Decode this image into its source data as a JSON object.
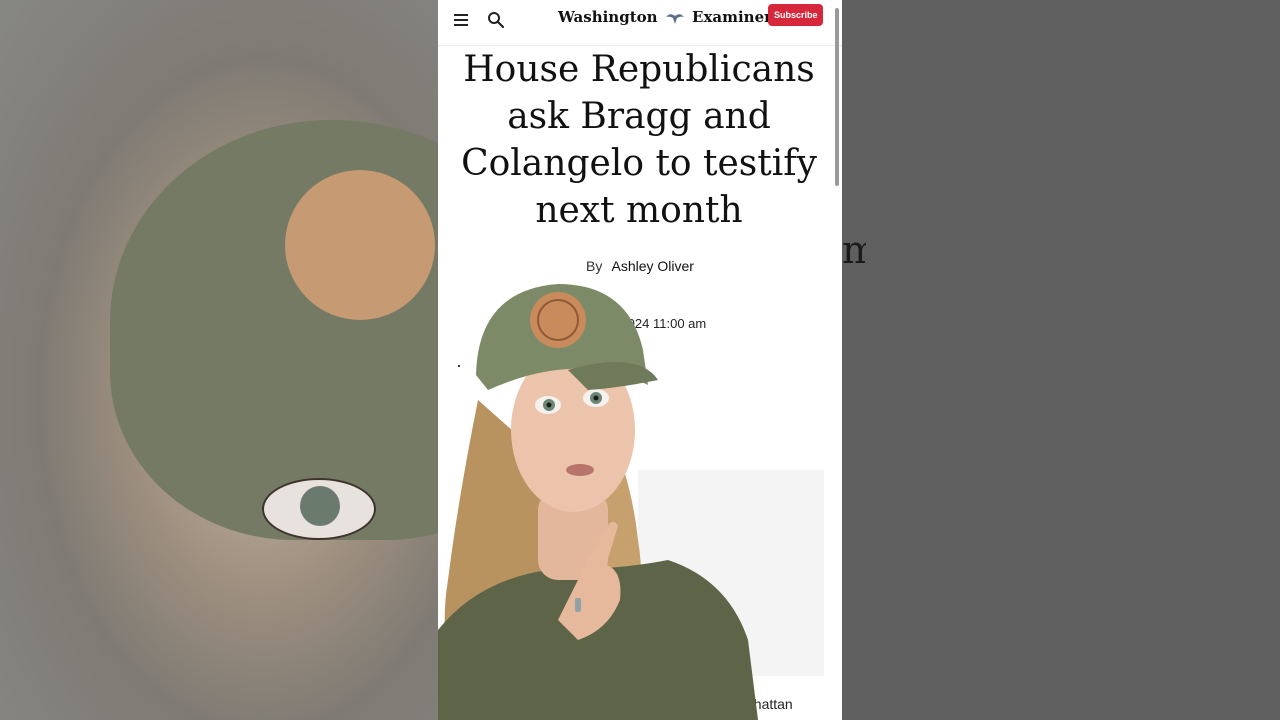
{
  "header": {
    "logo_text_1": "Washington",
    "logo_text_2": "Examiner",
    "subscribe_label": "Subscribe"
  },
  "article": {
    "headline": "House Republicans ask Bragg and Colangelo to testify next month",
    "by_label": "By",
    "author": "Ashley Oliver",
    "date_fragment": "1, 2024 11:00 am",
    "body_fragment": "nhattan"
  },
  "background": {
    "right_fragment": "m"
  },
  "icons": [
    "menu-icon",
    "search-icon",
    "eagle-icon"
  ],
  "colors": {
    "subscribe": "#d6283a",
    "cap": "#7d8a67",
    "badge": "#c98b5c",
    "shirt": "#5d6448"
  }
}
